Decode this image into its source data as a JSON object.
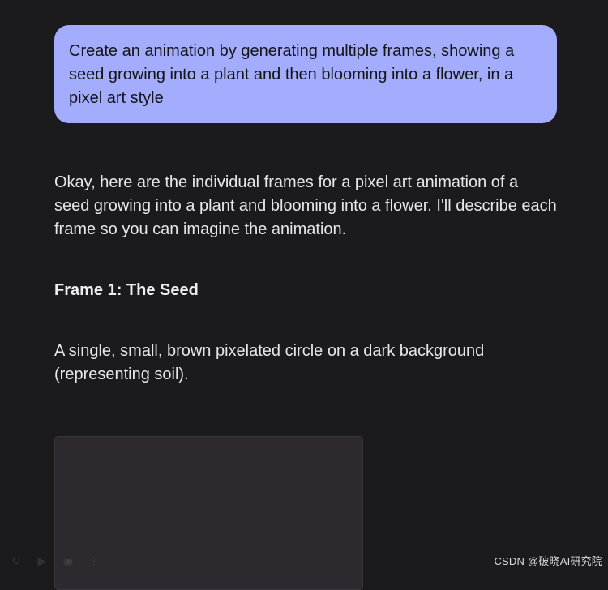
{
  "prompt": {
    "text": "Create an animation by generating multiple frames, showing a seed growing into a plant and then blooming into a flower, in a pixel art style"
  },
  "response": {
    "intro": "Okay, here are the individual frames for a pixel art animation of a seed growing into a plant and blooming into a flower. I'll describe each frame so you can imagine the animation.",
    "frame1_title": "Frame 1: The Seed",
    "frame1_description": "A single, small, brown pixelated circle on a dark background (representing soil)."
  },
  "watermark": {
    "text": "CSDN @破晓AI研究院"
  },
  "colors": {
    "background": "#1b1b1d",
    "prompt_bubble": "#a4acfd",
    "image_frame": "#2d292f",
    "text": "#e7e7e7"
  },
  "faint_controls": {
    "icons": [
      "replay-icon",
      "play-icon",
      "share-icon",
      "more-icon"
    ]
  }
}
